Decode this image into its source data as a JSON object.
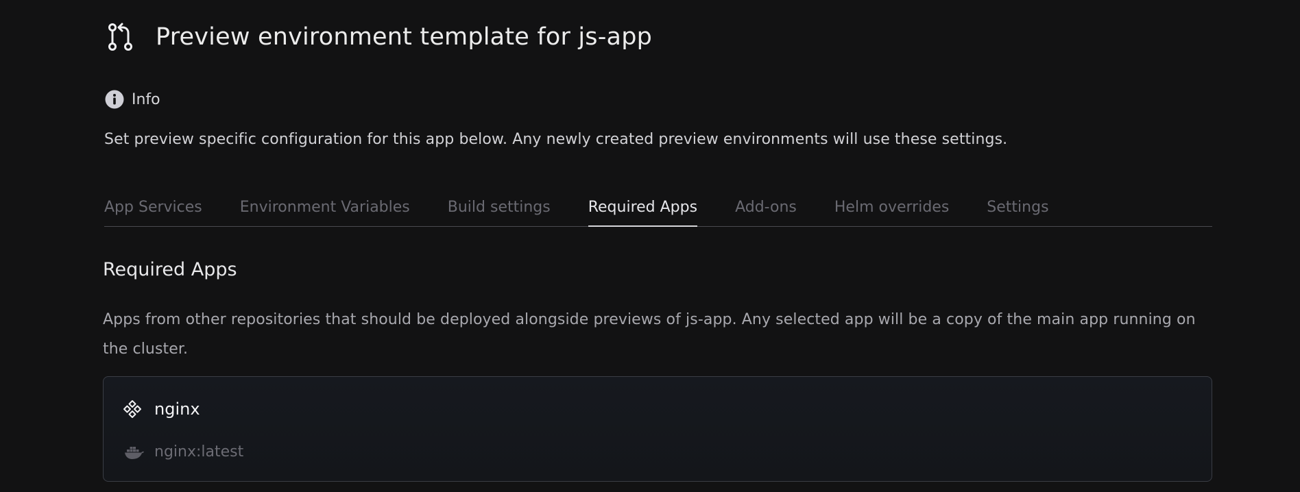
{
  "header": {
    "title": "Preview environment template for js-app",
    "icon": "git-pull-request-icon"
  },
  "info": {
    "label": "Info",
    "description": "Set preview specific configuration for this app below. Any newly created preview environments will use these settings."
  },
  "tabs": [
    {
      "label": "App Services",
      "active": false
    },
    {
      "label": "Environment Variables",
      "active": false
    },
    {
      "label": "Build settings",
      "active": false
    },
    {
      "label": "Required Apps",
      "active": true
    },
    {
      "label": "Add-ons",
      "active": false
    },
    {
      "label": "Helm overrides",
      "active": false
    },
    {
      "label": "Settings",
      "active": false
    }
  ],
  "section": {
    "title": "Required Apps",
    "description": "Apps from other repositories that should be deployed alongside previews of js-app. Any selected app will be a copy of the main app running on the cluster."
  },
  "apps": [
    {
      "name": "nginx",
      "image": "nginx:latest",
      "icon": "component-icon",
      "image_icon": "docker-icon"
    }
  ],
  "colors": {
    "background": "#121213",
    "active_tab": "#e6e6ea",
    "inactive_tab": "#6a6a72",
    "card_border": "#3a3d45"
  }
}
